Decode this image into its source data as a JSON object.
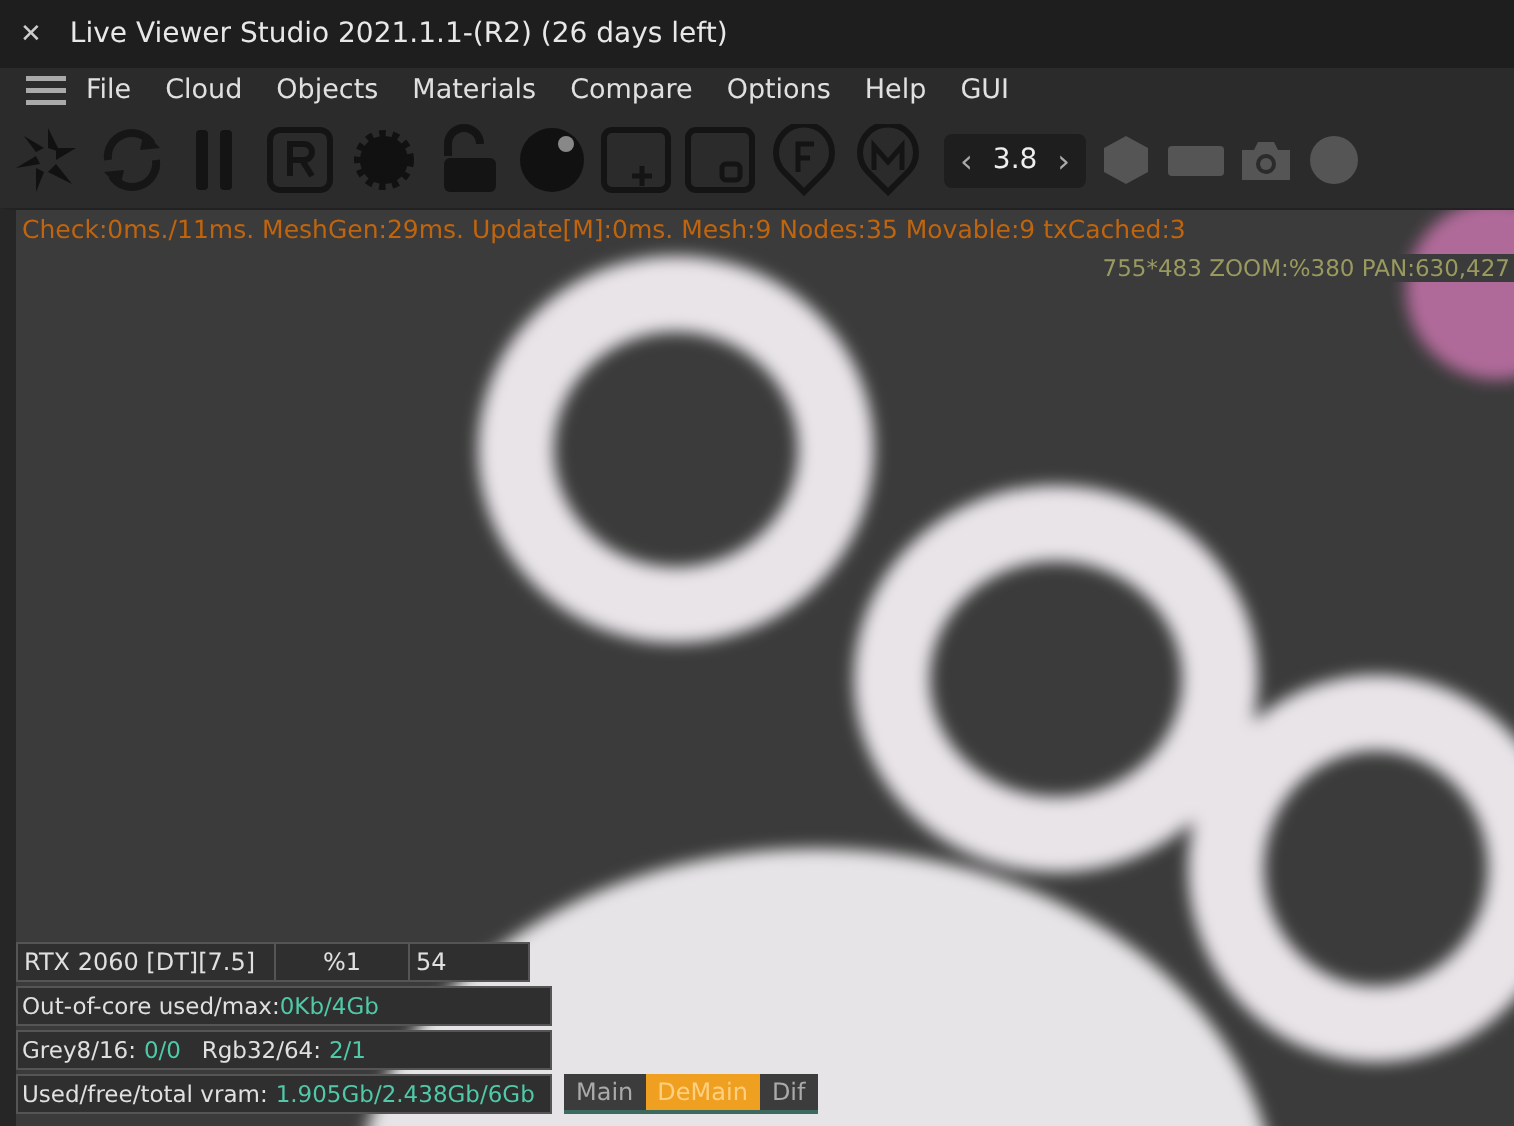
{
  "window": {
    "title": "Live Viewer Studio 2021.1.1-(R2) (26 days left)",
    "close": "✕"
  },
  "menu": [
    "File",
    "Cloud",
    "Objects",
    "Materials",
    "Compare",
    "Options",
    "Help",
    "GUI"
  ],
  "toolbar": {
    "stepper": {
      "prev": "‹",
      "value": "3.8",
      "next": "›"
    }
  },
  "viewport": {
    "stats": "Check:0ms./11ms. MeshGen:29ms. Update[M]:0ms. Mesh:9 Nodes:35 Movable:9 txCached:3",
    "view_info": "755*483 ZOOM:%380  PAN:630,427"
  },
  "info_panel": {
    "gpu": {
      "name": "RTX 2060 [DT][7.5]",
      "percent": "%1",
      "value": "54"
    },
    "out_of_core": {
      "label": "Out-of-core used/max:",
      "value": "0Kb/4Gb"
    },
    "grey": {
      "label": "Grey8/16:",
      "value": "0/0"
    },
    "rgb": {
      "label": "Rgb32/64:",
      "value": "2/1"
    },
    "vram": {
      "label": "Used/free/total vram:",
      "value": "1.905Gb/2.438Gb/6Gb"
    }
  },
  "view_tabs": [
    {
      "label": "Main",
      "selected": false
    },
    {
      "label": "DeMain",
      "selected": true
    },
    {
      "label": "Dif",
      "selected": false
    }
  ]
}
